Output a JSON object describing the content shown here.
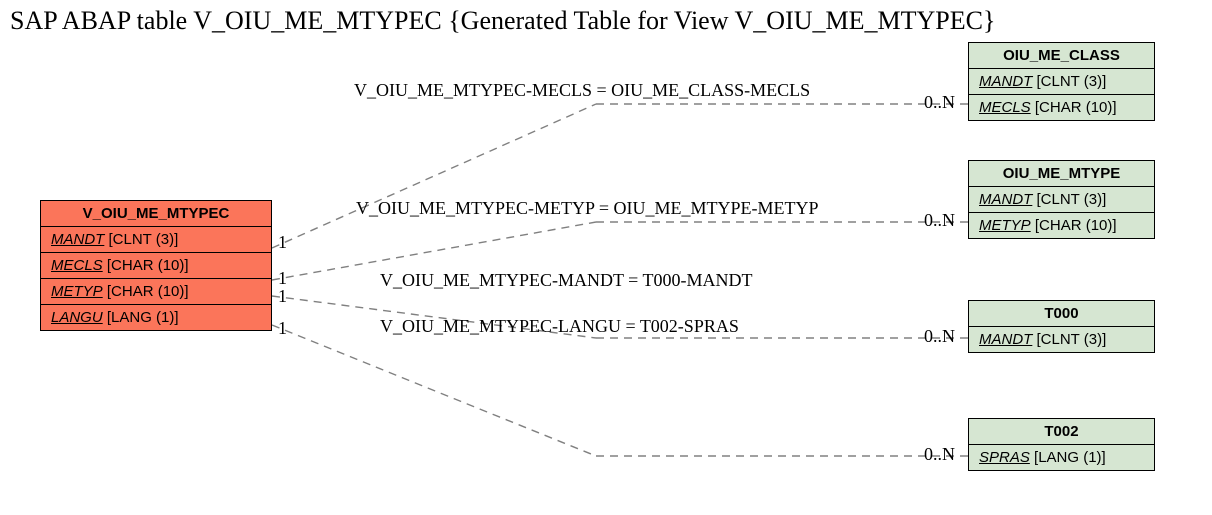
{
  "title": "SAP ABAP table V_OIU_ME_MTYPEC {Generated Table for View V_OIU_ME_MTYPEC}",
  "source": {
    "name": "V_OIU_ME_MTYPEC",
    "fields": [
      {
        "name": "MANDT",
        "type": "[CLNT (3)]"
      },
      {
        "name": "MECLS",
        "type": "[CHAR (10)]"
      },
      {
        "name": "METYP",
        "type": "[CHAR (10)]"
      },
      {
        "name": "LANGU",
        "type": "[LANG (1)]"
      }
    ]
  },
  "targets": [
    {
      "name": "OIU_ME_CLASS",
      "fields": [
        {
          "name": "MANDT",
          "type": "[CLNT (3)]"
        },
        {
          "name": "MECLS",
          "type": "[CHAR (10)]"
        }
      ]
    },
    {
      "name": "OIU_ME_MTYPE",
      "fields": [
        {
          "name": "MANDT",
          "type": "[CLNT (3)]"
        },
        {
          "name": "METYP",
          "type": "[CHAR (10)]"
        }
      ]
    },
    {
      "name": "T000",
      "fields": [
        {
          "name": "MANDT",
          "type": "[CLNT (3)]"
        }
      ]
    },
    {
      "name": "T002",
      "fields": [
        {
          "name": "SPRAS",
          "type": "[LANG (1)]"
        }
      ]
    }
  ],
  "relations": [
    {
      "label": "V_OIU_ME_MTYPEC-MECLS = OIU_ME_CLASS-MECLS",
      "left": "1",
      "right": "0..N"
    },
    {
      "label": "V_OIU_ME_MTYPEC-METYP = OIU_ME_MTYPE-METYP",
      "left": "1",
      "right": "0..N"
    },
    {
      "label": "V_OIU_ME_MTYPEC-MANDT = T000-MANDT",
      "left": "1",
      "right": "0..N"
    },
    {
      "label": "V_OIU_ME_MTYPEC-LANGU = T002-SPRAS",
      "left": "1",
      "right": "0..N"
    }
  ]
}
